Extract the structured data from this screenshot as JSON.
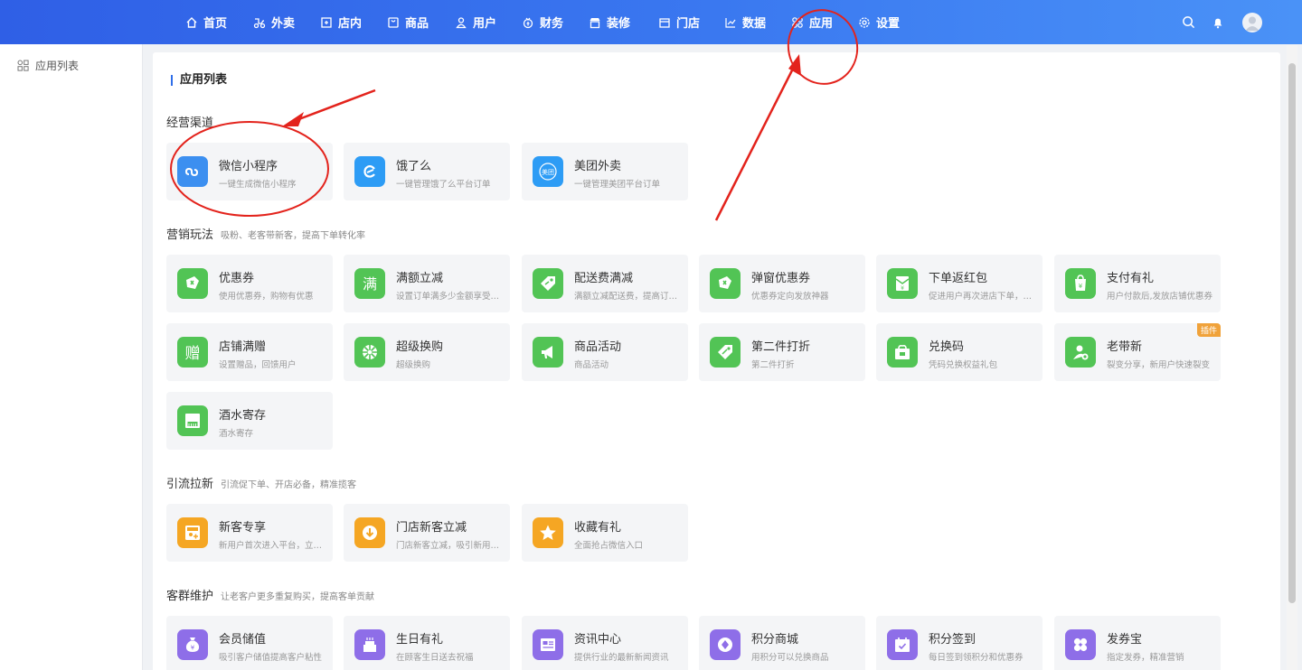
{
  "nav": {
    "items": [
      {
        "label": "首页",
        "icon": "home-icon"
      },
      {
        "label": "外卖",
        "icon": "delivery-icon"
      },
      {
        "label": "店内",
        "icon": "store-inside-icon"
      },
      {
        "label": "商品",
        "icon": "product-icon"
      },
      {
        "label": "用户",
        "icon": "user-icon"
      },
      {
        "label": "财务",
        "icon": "finance-icon"
      },
      {
        "label": "装修",
        "icon": "decor-icon"
      },
      {
        "label": "门店",
        "icon": "shop-icon"
      },
      {
        "label": "数据",
        "icon": "chart-icon"
      },
      {
        "label": "应用",
        "icon": "apps-icon"
      },
      {
        "label": "设置",
        "icon": "gear-icon"
      }
    ]
  },
  "sidebar": {
    "item_label": "应用列表"
  },
  "panel": {
    "title": "应用列表"
  },
  "sections": {
    "channels": {
      "title": "经营渠道",
      "sub": ""
    },
    "marketing": {
      "title": "营销玩法",
      "sub": "吸粉、老客带新客，提高下单转化率"
    },
    "traffic": {
      "title": "引流拉新",
      "sub": "引流促下单、开店必备，精准揽客"
    },
    "retention": {
      "title": "客群维护",
      "sub": "让老客户更多重复购买，提高客单贡献"
    }
  },
  "cards": {
    "c1": {
      "title": "微信小程序",
      "desc": "一键生成微信小程序"
    },
    "c2": {
      "title": "饿了么",
      "desc": "一键管理饿了么平台订单"
    },
    "c3": {
      "title": "美团外卖",
      "desc": "一键管理美团平台订单",
      "icon_text": "美团"
    },
    "m1": {
      "title": "优惠券",
      "desc": "使用优惠券，购物有优惠"
    },
    "m2": {
      "title": "满额立减",
      "desc": "设置订单满多少金额享受立减",
      "icon_text": "满"
    },
    "m3": {
      "title": "配送费满减",
      "desc": "满额立减配送费，提高订单量"
    },
    "m4": {
      "title": "弹窗优惠券",
      "desc": "优惠券定向发放神器"
    },
    "m5": {
      "title": "下单返红包",
      "desc": "促进用户再次进店下单，提升复购"
    },
    "m6": {
      "title": "支付有礼",
      "desc": "用户付款后,发放店铺优惠券"
    },
    "m7": {
      "title": "店铺满赠",
      "desc": "设置赠品，回馈用户",
      "icon_text": "赠"
    },
    "m8": {
      "title": "超级换购",
      "desc": "超级换购"
    },
    "m9": {
      "title": "商品活动",
      "desc": "商品活动"
    },
    "m10": {
      "title": "第二件打折",
      "desc": "第二件打折"
    },
    "m11": {
      "title": "兑换码",
      "desc": "凭码兑换权益礼包"
    },
    "m12": {
      "title": "老带新",
      "desc": "裂变分享，新用户快速裂变",
      "badge": "插件"
    },
    "m13": {
      "title": "酒水寄存",
      "desc": "酒水寄存"
    },
    "t1": {
      "title": "新客专享",
      "desc": "新用户首次进入平台，立享专属优惠"
    },
    "t2": {
      "title": "门店新客立减",
      "desc": "门店新客立减，吸引新用户下单"
    },
    "t3": {
      "title": "收藏有礼",
      "desc": "全面抢占微信入口"
    },
    "r1": {
      "title": "会员储值",
      "desc": "吸引客户储值提高客户粘性"
    },
    "r2": {
      "title": "生日有礼",
      "desc": "在顾客生日送去祝福"
    },
    "r3": {
      "title": "资讯中心",
      "desc": "提供行业的最新新闻资讯"
    },
    "r4": {
      "title": "积分商城",
      "desc": "用积分可以兑换商品"
    },
    "r5": {
      "title": "积分签到",
      "desc": "每日签到领积分和优惠券"
    },
    "r6": {
      "title": "发券宝",
      "desc": "指定发券，精准营销"
    }
  },
  "colors": {
    "nav_gradient_start": "#2f5fe6",
    "nav_gradient_end": "#4a92f7",
    "accent_blue": "#2f6ee9",
    "green_icon": "#52c455",
    "orange_icon": "#f5a623",
    "purple_icon": "#8e6ee8",
    "annotation_red": "#e3231c"
  }
}
